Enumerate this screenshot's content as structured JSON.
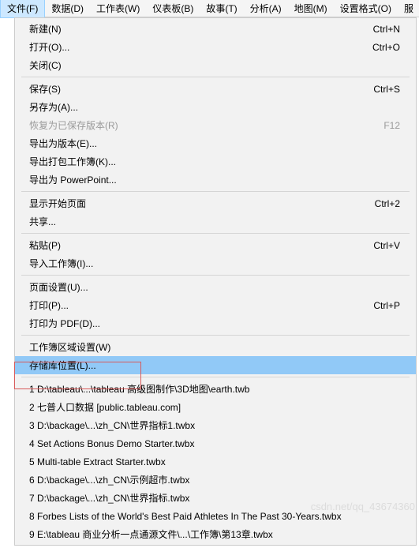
{
  "menubar": [
    {
      "label": "文件(F)",
      "active": true
    },
    {
      "label": "数据(D)"
    },
    {
      "label": "工作表(W)"
    },
    {
      "label": "仪表板(B)"
    },
    {
      "label": "故事(T)"
    },
    {
      "label": "分析(A)"
    },
    {
      "label": "地图(M)"
    },
    {
      "label": "设置格式(O)"
    },
    {
      "label": "服"
    }
  ],
  "menu": {
    "groups": [
      [
        {
          "label": "新建(N)",
          "shortcut": "Ctrl+N"
        },
        {
          "label": "打开(O)...",
          "shortcut": "Ctrl+O"
        },
        {
          "label": "关闭(C)"
        }
      ],
      [
        {
          "label": "保存(S)",
          "shortcut": "Ctrl+S"
        },
        {
          "label": "另存为(A)..."
        },
        {
          "label": "恢复为已保存版本(R)",
          "shortcut": "F12",
          "disabled": true
        },
        {
          "label": "导出为版本(E)..."
        },
        {
          "label": "导出打包工作簿(K)..."
        },
        {
          "label": "导出为 PowerPoint..."
        }
      ],
      [
        {
          "label": "显示开始页面",
          "shortcut": "Ctrl+2"
        },
        {
          "label": "共享..."
        }
      ],
      [
        {
          "label": "粘贴(P)",
          "shortcut": "Ctrl+V"
        },
        {
          "label": "导入工作簿(I)..."
        }
      ],
      [
        {
          "label": "页面设置(U)..."
        },
        {
          "label": "打印(P)...",
          "shortcut": "Ctrl+P"
        },
        {
          "label": "打印为 PDF(D)..."
        }
      ],
      [
        {
          "label": "工作簿区域设置(W)"
        },
        {
          "label": "存储库位置(L)...",
          "highlighted": true
        }
      ],
      [
        {
          "label": "1 D:\\tableau\\...\\tableau 高级图制作\\3D地图\\earth.twb"
        },
        {
          "label": "2 七普人口数据 [public.tableau.com]"
        },
        {
          "label": "3 D:\\backage\\...\\zh_CN\\世界指标1.twbx"
        },
        {
          "label": "4 Set Actions Bonus Demo Starter.twbx"
        },
        {
          "label": "5 Multi-table Extract Starter.twbx"
        },
        {
          "label": "6 D:\\backage\\...\\zh_CN\\示例超市.twbx"
        },
        {
          "label": "7 D:\\backage\\...\\zh_CN\\世界指标.twbx"
        },
        {
          "label": "8 Forbes Lists of the World's Best Paid Athletes  In The Past 30-Years.twbx"
        },
        {
          "label": "9 E:\\tableau 商业分析一点通源文件\\...\\工作簿\\第13章.twbx"
        }
      ]
    ]
  },
  "watermark": "csdn.net/qq_43674360"
}
